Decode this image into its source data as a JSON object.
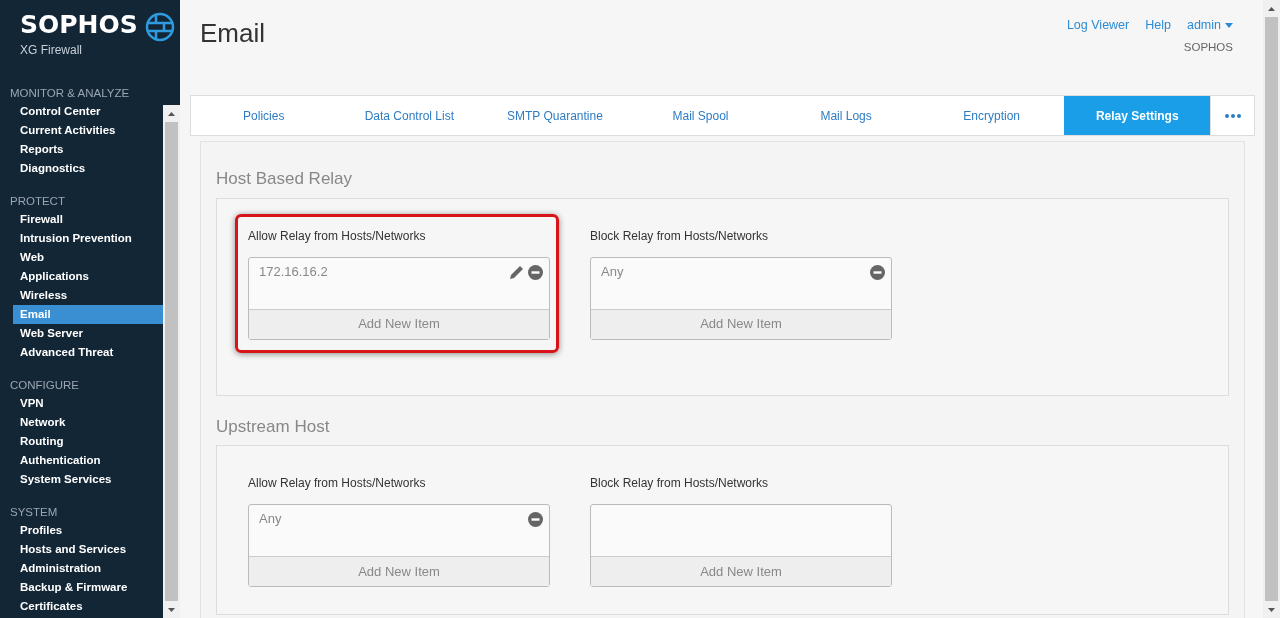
{
  "brand": {
    "name": "SOPHOS",
    "product": "XG Firewall"
  },
  "sidebar": {
    "sections": [
      {
        "title": "MONITOR & ANALYZE",
        "items": [
          {
            "label": "Control Center",
            "selected": false
          },
          {
            "label": "Current Activities",
            "selected": false
          },
          {
            "label": "Reports",
            "selected": false
          },
          {
            "label": "Diagnostics",
            "selected": false
          }
        ]
      },
      {
        "title": "PROTECT",
        "items": [
          {
            "label": "Firewall",
            "selected": false
          },
          {
            "label": "Intrusion Prevention",
            "selected": false
          },
          {
            "label": "Web",
            "selected": false
          },
          {
            "label": "Applications",
            "selected": false
          },
          {
            "label": "Wireless",
            "selected": false
          },
          {
            "label": "Email",
            "selected": true
          },
          {
            "label": "Web Server",
            "selected": false
          },
          {
            "label": "Advanced Threat",
            "selected": false
          }
        ]
      },
      {
        "title": "CONFIGURE",
        "items": [
          {
            "label": "VPN",
            "selected": false
          },
          {
            "label": "Network",
            "selected": false
          },
          {
            "label": "Routing",
            "selected": false
          },
          {
            "label": "Authentication",
            "selected": false
          },
          {
            "label": "System Services",
            "selected": false
          }
        ]
      },
      {
        "title": "SYSTEM",
        "items": [
          {
            "label": "Profiles",
            "selected": false
          },
          {
            "label": "Hosts and Services",
            "selected": false
          },
          {
            "label": "Administration",
            "selected": false
          },
          {
            "label": "Backup & Firmware",
            "selected": false
          },
          {
            "label": "Certificates",
            "selected": false
          }
        ]
      }
    ]
  },
  "header": {
    "title": "Email",
    "links": [
      "Log Viewer",
      "Help"
    ],
    "user": "admin",
    "organization": "SOPHOS"
  },
  "tabs": [
    {
      "label": "Policies",
      "selected": false
    },
    {
      "label": "Data Control List",
      "selected": false
    },
    {
      "label": "SMTP Quarantine",
      "selected": false
    },
    {
      "label": "Mail Spool",
      "selected": false
    },
    {
      "label": "Mail Logs",
      "selected": false
    },
    {
      "label": "Encryption",
      "selected": false
    },
    {
      "label": "Relay Settings",
      "selected": true
    }
  ],
  "sections": [
    {
      "title": "Host Based Relay",
      "lists": [
        {
          "label": "Allow Relay from Hosts/Networks",
          "highlighted": true,
          "items": [
            {
              "text": "172.16.16.2",
              "editable": true
            }
          ],
          "add_button": "Add New Item"
        },
        {
          "label": "Block Relay from Hosts/Networks",
          "highlighted": false,
          "items": [
            {
              "text": "Any",
              "editable": false
            }
          ],
          "add_button": "Add New Item"
        }
      ]
    },
    {
      "title": "Upstream Host",
      "lists": [
        {
          "label": "Allow Relay from Hosts/Networks",
          "highlighted": false,
          "items": [
            {
              "text": "Any",
              "editable": false
            }
          ],
          "add_button": "Add New Item"
        },
        {
          "label": "Block Relay from Hosts/Networks",
          "highlighted": false,
          "add_button": "Add New Item"
        }
      ]
    }
  ]
}
